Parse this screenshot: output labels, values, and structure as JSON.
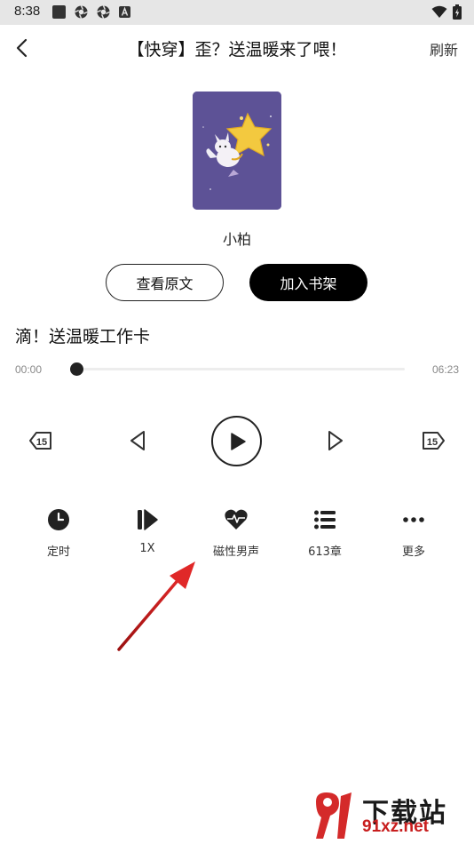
{
  "status_bar": {
    "time": "8:38"
  },
  "header": {
    "title": "【快穿】歪？送温暖来了喂！",
    "refresh_label": "刷新"
  },
  "book": {
    "author": "小柏",
    "view_original_label": "查看原文",
    "add_shelf_label": "加入书架"
  },
  "chapter": {
    "title": "滴！送温暖工作卡"
  },
  "player": {
    "current_time": "00:00",
    "total_time": "06:23",
    "progress": 0
  },
  "menu": {
    "timer_label": "定时",
    "speed_label": "1X",
    "voice_label": "磁性男声",
    "chapters_label": "613章",
    "more_label": "更多"
  },
  "watermark": {
    "line1": "下载站",
    "line2": "91xz.net"
  },
  "colors": {
    "accent": "#000000",
    "arrow": "#d42020",
    "cover": "#5d5296"
  }
}
